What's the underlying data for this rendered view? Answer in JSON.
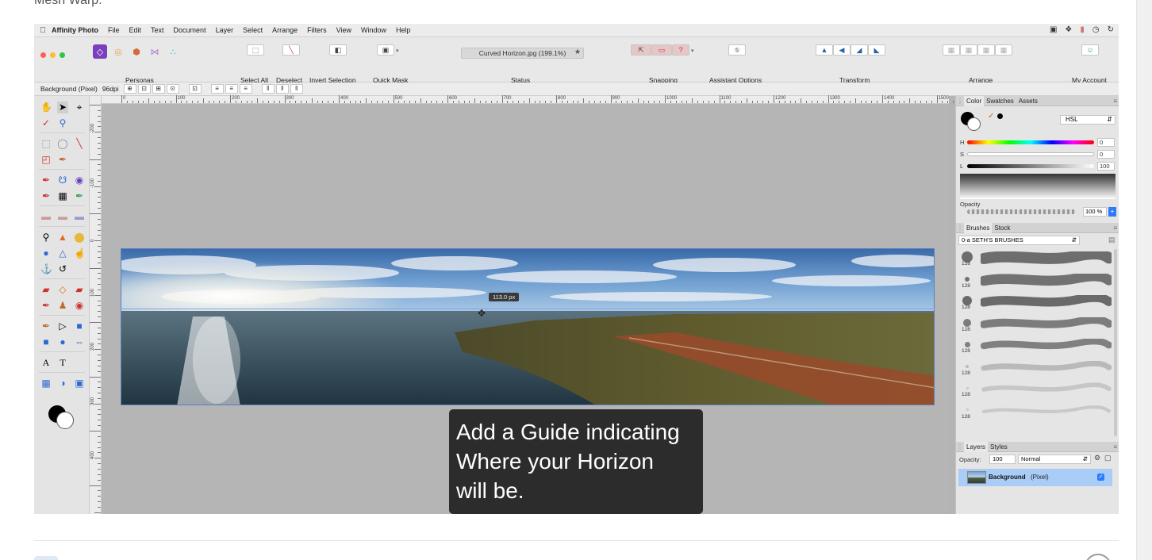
{
  "page": {
    "caption": "Mesh Warp."
  },
  "menubar": {
    "app_name": "Affinity Photo",
    "items": [
      "File",
      "Edit",
      "Text",
      "Document",
      "Layer",
      "Select",
      "Arrange",
      "Filters",
      "View",
      "Window",
      "Help"
    ]
  },
  "toolbar": {
    "personas_label": "Personas",
    "select_all": "Select All",
    "deselect": "Deselect",
    "invert_selection": "Invert Selection",
    "quick_mask": "Quick Mask",
    "document_title": "Curved Horizon.jpg (199.1%)",
    "status_label": "Status",
    "snapping": "Snapping",
    "assistant_options": "Assistant Options",
    "transform": "Transform",
    "arrange": "Arrange",
    "my_account": "My Account"
  },
  "context": {
    "layer_info": "Background (Pixel)",
    "dpi": "96dpi"
  },
  "rulers": {
    "unit": "px",
    "top_ticks": [
      "0",
      "100",
      "200",
      "300",
      "400",
      "500",
      "600",
      "700",
      "800",
      "900",
      "1000",
      "1100",
      "1200",
      "1300",
      "1400",
      "1500"
    ],
    "left_ticks": [
      "-200",
      "-100",
      "0",
      "100",
      "200",
      "300",
      "400"
    ]
  },
  "canvas": {
    "guide_tooltip": "113.0 px",
    "subtitle_lines": [
      "Add a Guide indicating",
      "Where your Horizon",
      "will be."
    ]
  },
  "color_panel": {
    "tabs": [
      "Color",
      "Swatches",
      "Assets"
    ],
    "model": "HSL",
    "h_label": "H",
    "h_value": "0",
    "s_label": "S",
    "s_value": "0",
    "l_label": "L",
    "l_value": "100",
    "opacity_label": "Opacity",
    "opacity_value": "100 %"
  },
  "brushes_panel": {
    "tabs": [
      "Brushes",
      "Stock"
    ],
    "category": "0-a SETH'S BRUSHES",
    "brush_sizes": [
      "128",
      "128",
      "128",
      "128",
      "128",
      "128",
      "128",
      "128"
    ]
  },
  "layers_panel": {
    "tabs": [
      "Layers",
      "Styles"
    ],
    "opacity_label": "Opacity:",
    "opacity_value": "100",
    "blend_mode": "Normal",
    "layer_name": "Background",
    "layer_type": "(Pixel)"
  },
  "colors": {
    "accent": "#2d7cf6",
    "selection": "#a9cdf7",
    "affinity_purple": "#7a3fbf"
  }
}
